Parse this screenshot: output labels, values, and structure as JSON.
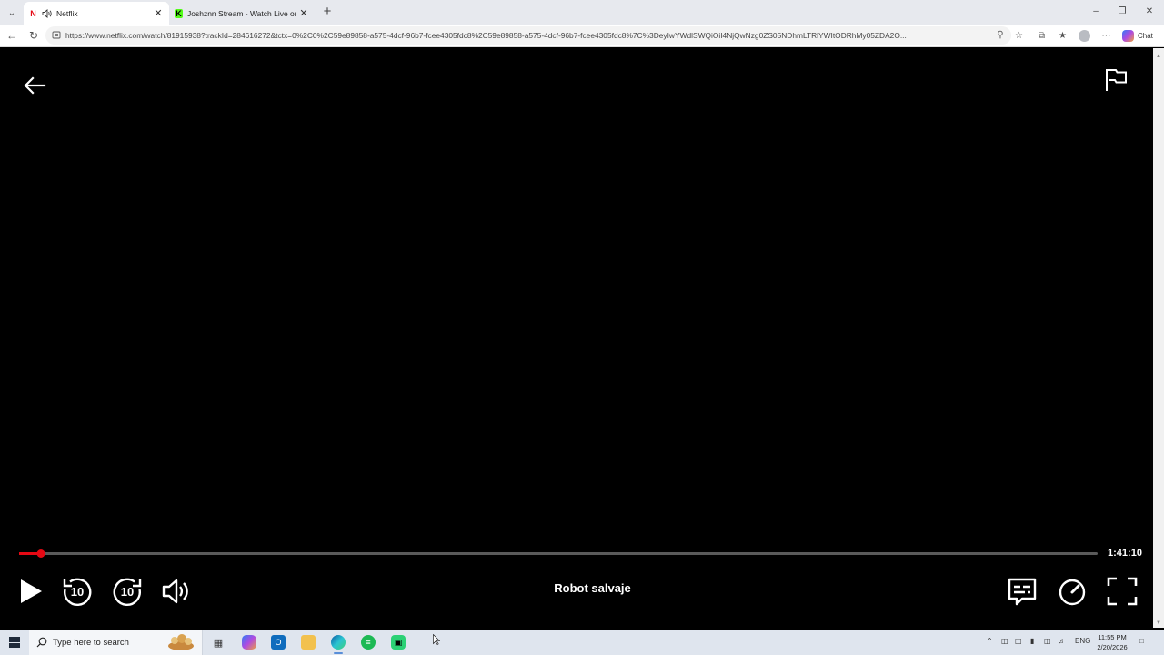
{
  "browser": {
    "tabs": [
      {
        "title": "Netflix",
        "active": true
      },
      {
        "title": "Joshznn Stream - Watch Live on K",
        "active": false
      }
    ],
    "url": "https://www.netflix.com/watch/81915938?trackId=284616272&tctx=0%2C0%2C59e89858-a575-4dcf-96b7-fcee4305fdc8%2C59e89858-a575-4dcf-96b7-fcee4305fdc8%7C%3DeyIwYWdlSWQiOiI4NjQwNzg0ZS05NDhmLTRlYWItODRhMy05ZDA2O...",
    "chat_label": "Chat"
  },
  "player": {
    "title": "Robot salvaje",
    "time_remaining": "1:41:10",
    "progress_fraction": 0.02,
    "skip_back_seconds": "10",
    "skip_forward_seconds": "10"
  },
  "taskbar": {
    "search_placeholder": "Type here to search",
    "language": "ENG",
    "time": "11:55 PM",
    "date": "2/20/2026"
  },
  "colors": {
    "netflix_red": "#e50914",
    "kick_green": "#53fc18",
    "spotify_green": "#1db954"
  },
  "icons": {
    "back": "arrow-left-icon",
    "report": "flag-icon",
    "play": "play-icon",
    "rewind": "rewind-10-icon",
    "forward": "forward-10-icon",
    "volume": "volume-icon",
    "subtitles": "subtitles-icon",
    "speed": "playback-speed-icon",
    "fullscreen": "fullscreen-icon"
  }
}
